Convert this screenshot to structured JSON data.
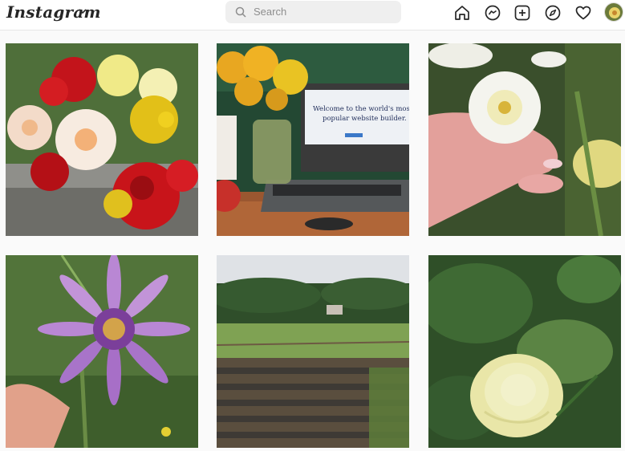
{
  "app": {
    "logo_text": "Instagram"
  },
  "search": {
    "placeholder": "Search"
  },
  "nav": {
    "icons": [
      "home-icon",
      "messenger-icon",
      "new-post-icon",
      "explore-icon",
      "activity-heart-icon",
      "profile-avatar"
    ]
  },
  "grid": {
    "posts": [
      {
        "name": "post-tile-flower-bouquet"
      },
      {
        "name": "post-tile-laptop-daffodils"
      },
      {
        "name": "post-tile-white-daffodil"
      },
      {
        "name": "post-tile-purple-flower"
      },
      {
        "name": "post-tile-farm-field"
      },
      {
        "name": "post-tile-yellow-rose"
      }
    ],
    "laptop_screen_text_line1": "Welcome to the world's most",
    "laptop_screen_text_line2": "popular website builder."
  },
  "colors": {
    "topbar_bg": "#ffffff",
    "page_bg": "#fafafa",
    "text": "#262626",
    "muted": "#8e8e8e"
  }
}
